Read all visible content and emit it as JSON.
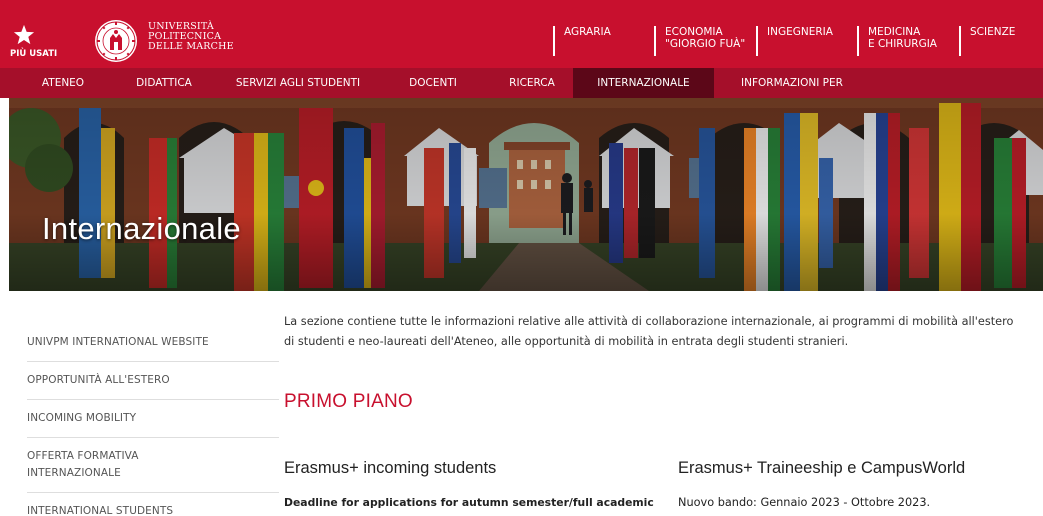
{
  "header": {
    "favorites_label": "PIÙ USATI",
    "university_name": [
      "UNIVERSITÀ",
      "POLITECNICA",
      "DELLE MARCHE"
    ],
    "faculties": [
      {
        "lines": [
          "AGRARIA"
        ]
      },
      {
        "lines": [
          "ECONOMIA",
          "\"GIORGIO FUÀ\""
        ]
      },
      {
        "lines": [
          "INGEGNERIA"
        ]
      },
      {
        "lines": [
          "MEDICINA",
          "E CHIRURGIA"
        ]
      },
      {
        "lines": [
          "SCIENZE"
        ]
      }
    ],
    "colors": {
      "brand_red": "#c8102e",
      "nav_red": "#a50f2a",
      "active_tab": "#5c0718"
    }
  },
  "main_nav": {
    "items": [
      "ATENEO",
      "DIDATTICA",
      "SERVIZI AGLI STUDENTI",
      "DOCENTI",
      "RICERCA",
      "INTERNAZIONALE",
      "INFORMAZIONI PER"
    ],
    "active": "INTERNAZIONALE"
  },
  "hero": {
    "title": "Internazionale"
  },
  "sidebar": {
    "items": [
      {
        "lines": [
          "UNIVPM INTERNATIONAL WEBSITE"
        ]
      },
      {
        "lines": [
          "OPPORTUNITÀ ALL'ESTERO"
        ]
      },
      {
        "lines": [
          "INCOMING MOBILITY"
        ]
      },
      {
        "lines": [
          "OFFERTA FORMATIVA",
          "INTERNAZIONALE"
        ]
      },
      {
        "lines": [
          "INTERNATIONAL STUDENTS"
        ]
      }
    ]
  },
  "content": {
    "intro_lines": [
      "La sezione contiene tutte le informazioni relative alle attività di collaborazione internazionale, ai programmi di mobilità all'estero",
      "di studenti e neo-laureati dell'Ateneo, alle opportunità di mobilità in entrata degli studenti stranieri."
    ],
    "section_title": "PRIMO PIANO",
    "cards": [
      {
        "title": "Erasmus+ incoming students",
        "text": "Deadline for applications for autumn semester/full academic"
      },
      {
        "title": "Erasmus+ Traineeship e CampusWorld",
        "text": "Nuovo bando: Gennaio 2023 - Ottobre 2023."
      }
    ]
  }
}
